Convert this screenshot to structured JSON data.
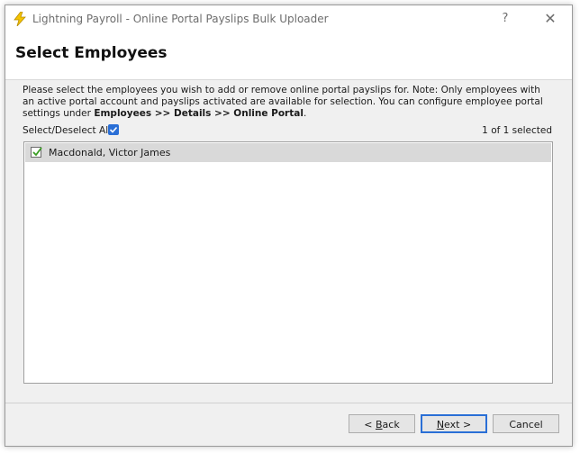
{
  "window": {
    "title": "Lightning Payroll - Online Portal Payslips Bulk Uploader",
    "help_label": "?",
    "close_label": "✕"
  },
  "header": {
    "title": "Select Employees"
  },
  "description": {
    "text": "Please select the employees you wish to add or remove online portal payslips for. Note: Only employees with an active portal account and payslips activated are available for selection. You can configure employee portal settings under ",
    "bold": "Employees >> Details >> Online Portal",
    "end": "."
  },
  "selection": {
    "select_all_label": "Select/Deselect All",
    "select_all_checked": true,
    "count_text": "1 of 1 selected"
  },
  "employees": [
    {
      "name": "Macdonald, Victor James",
      "checked": true
    }
  ],
  "buttons": {
    "back_pre": "< ",
    "back_accel": "B",
    "back_post": "ack",
    "next_accel": "N",
    "next_post": "ext >",
    "cancel": "Cancel"
  },
  "colors": {
    "accent": "#2a6fd6",
    "check_green": "#3a9d23",
    "icon_yellow": "#f5c400"
  }
}
